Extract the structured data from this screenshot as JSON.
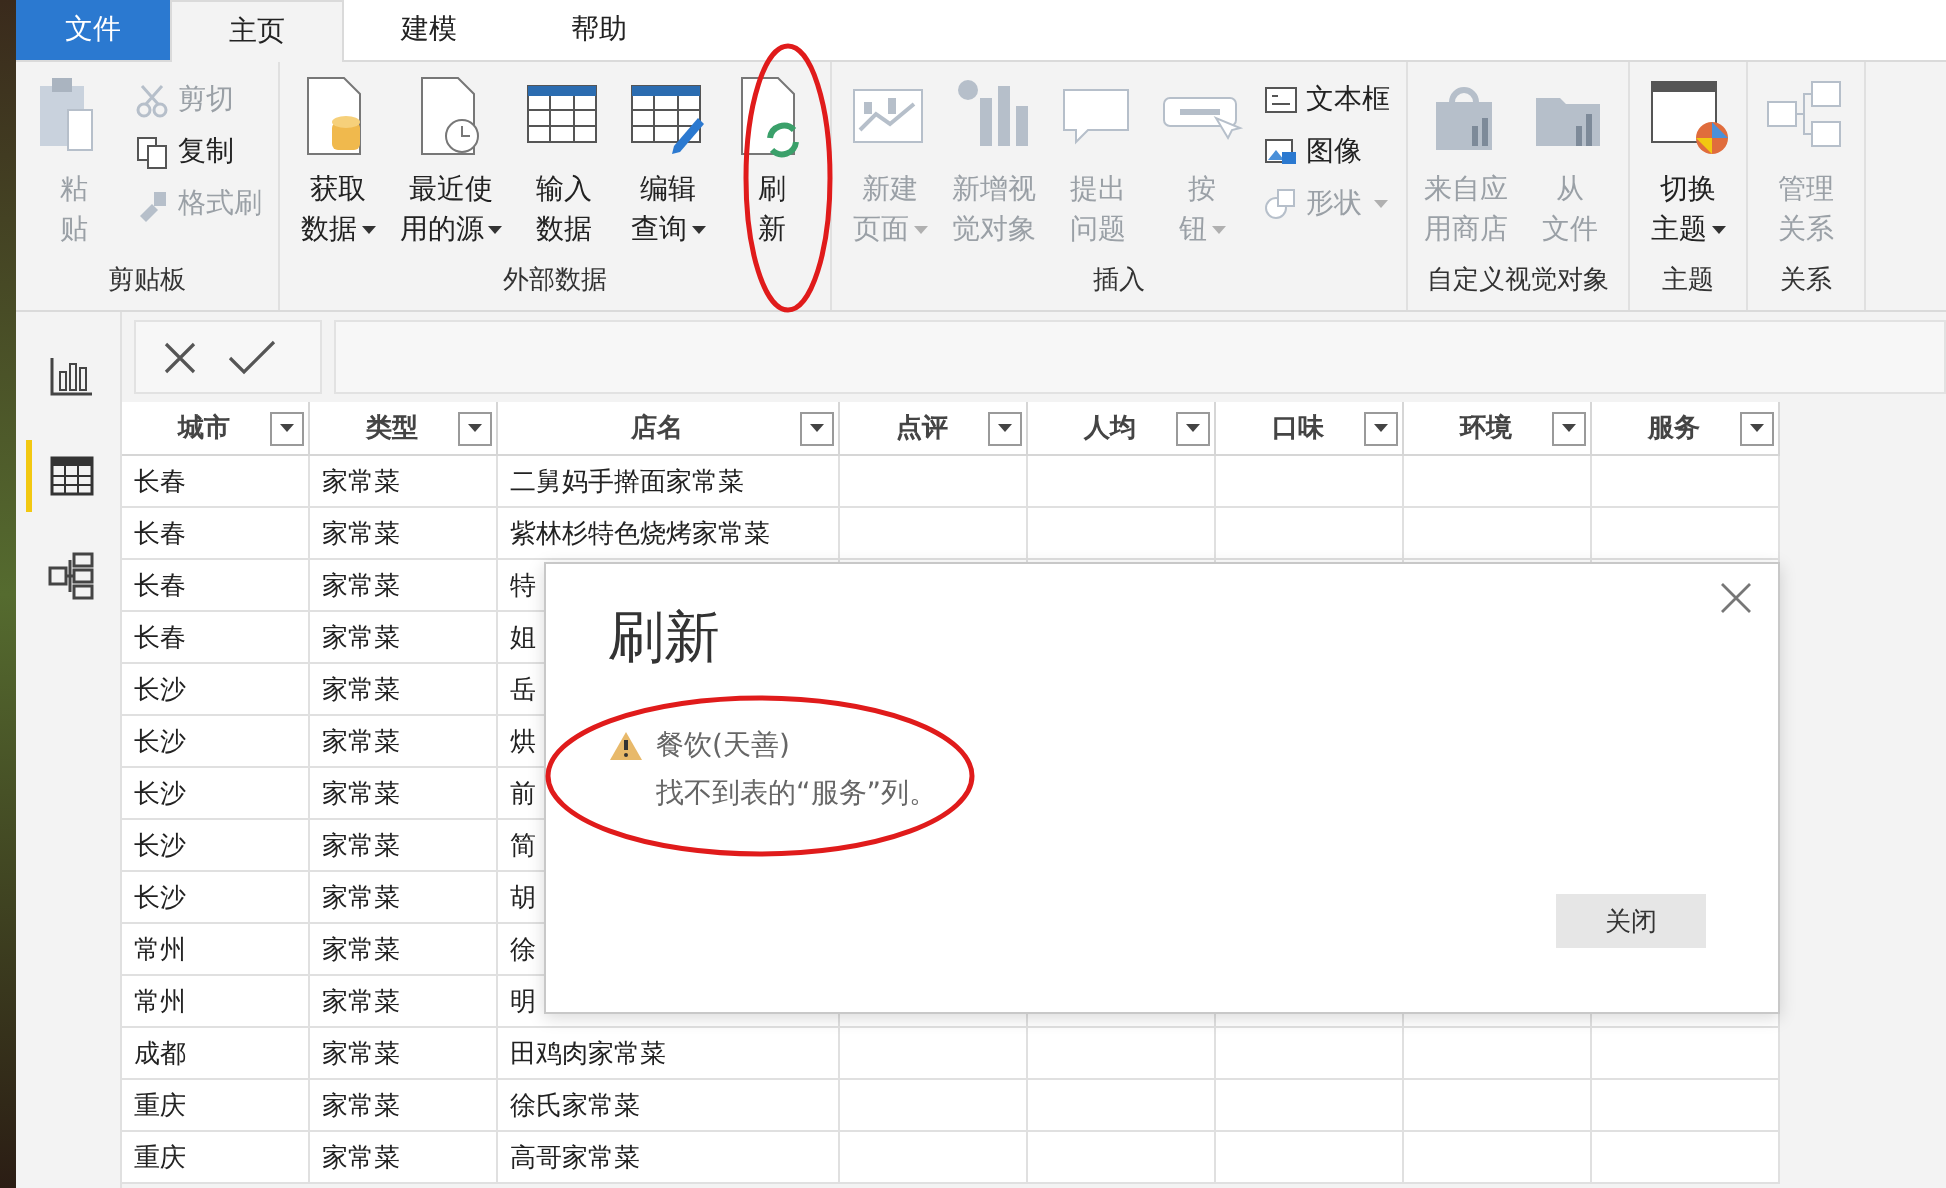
{
  "tabs": [
    {
      "label": "文件",
      "kind": "file",
      "selected": false
    },
    {
      "label": "主页",
      "kind": "tab",
      "selected": true
    },
    {
      "label": "建模",
      "kind": "tab",
      "selected": false
    },
    {
      "label": "帮助",
      "kind": "tab",
      "selected": false
    }
  ],
  "ribbon_groups": [
    {
      "label": "剪贴板",
      "buttons": [
        {
          "kind": "large",
          "lines": [
            "粘",
            "贴"
          ],
          "disabled": true,
          "dropdown": false
        },
        {
          "kind": "small",
          "label": "剪切",
          "disabled": true,
          "dropdown": false
        },
        {
          "kind": "small",
          "label": "复制",
          "disabled": false,
          "dropdown": false
        },
        {
          "kind": "small",
          "label": "格式刷",
          "disabled": true,
          "dropdown": false
        }
      ]
    },
    {
      "label": "外部数据",
      "buttons": [
        {
          "kind": "large",
          "lines": [
            "获取",
            "数据"
          ],
          "disabled": false,
          "dropdown": true
        },
        {
          "kind": "large",
          "lines": [
            "最近使",
            "用的源"
          ],
          "disabled": false,
          "dropdown": true
        },
        {
          "kind": "large",
          "lines": [
            "输入",
            "数据"
          ],
          "disabled": false,
          "dropdown": false
        },
        {
          "kind": "large",
          "lines": [
            "编辑",
            "查询"
          ],
          "disabled": false,
          "dropdown": true
        },
        {
          "kind": "large",
          "lines": [
            "刷",
            "新"
          ],
          "disabled": false,
          "dropdown": false
        }
      ]
    },
    {
      "label": "插入",
      "buttons": [
        {
          "kind": "large",
          "lines": [
            "新建",
            "页面"
          ],
          "disabled": true,
          "dropdown": true
        },
        {
          "kind": "large",
          "lines": [
            "新增视",
            "觉对象"
          ],
          "disabled": true,
          "dropdown": false
        },
        {
          "kind": "large",
          "lines": [
            "提出",
            "问题"
          ],
          "disabled": true,
          "dropdown": false
        },
        {
          "kind": "large",
          "lines": [
            "按",
            "钮"
          ],
          "disabled": true,
          "dropdown": true
        },
        {
          "kind": "small",
          "label": "文本框",
          "disabled": false,
          "dropdown": false
        },
        {
          "kind": "small",
          "label": "图像",
          "disabled": false,
          "dropdown": false
        },
        {
          "kind": "small",
          "label": "形状",
          "disabled": true,
          "dropdown": true
        }
      ]
    },
    {
      "label": "自定义视觉对象",
      "buttons": [
        {
          "kind": "large",
          "lines": [
            "来自应",
            "用商店"
          ],
          "disabled": true,
          "dropdown": false
        },
        {
          "kind": "large",
          "lines": [
            "从",
            "文件"
          ],
          "disabled": true,
          "dropdown": false
        }
      ]
    },
    {
      "label": "主题",
      "buttons": [
        {
          "kind": "large",
          "lines": [
            "切换",
            "主题"
          ],
          "disabled": false,
          "dropdown": true
        }
      ]
    },
    {
      "label": "关系",
      "buttons": [
        {
          "kind": "large",
          "lines": [
            "管理",
            "关系"
          ],
          "disabled": true,
          "dropdown": false
        }
      ]
    }
  ],
  "sidebar": {
    "items": [
      {
        "kind": "report",
        "selected": false
      },
      {
        "kind": "data",
        "selected": true
      },
      {
        "kind": "model",
        "selected": false
      }
    ]
  },
  "table": {
    "columns": [
      "城市",
      "类型",
      "店名",
      "点评",
      "人均",
      "口味",
      "环境",
      "服务"
    ],
    "rows": [
      [
        "长春",
        "家常菜",
        "二舅妈手擀面家常菜",
        "",
        "",
        "",
        "",
        ""
      ],
      [
        "长春",
        "家常菜",
        "紫林杉特色烧烤家常菜",
        "",
        "",
        "",
        "",
        ""
      ],
      [
        "长春",
        "家常菜",
        "特",
        "",
        "",
        "",
        "",
        ""
      ],
      [
        "长春",
        "家常菜",
        "姐",
        "",
        "",
        "",
        "",
        ""
      ],
      [
        "长沙",
        "家常菜",
        "岳",
        "",
        "",
        "",
        "",
        ""
      ],
      [
        "长沙",
        "家常菜",
        "烘",
        "",
        "",
        "",
        "",
        ""
      ],
      [
        "长沙",
        "家常菜",
        "前",
        "",
        "",
        "",
        "",
        ""
      ],
      [
        "长沙",
        "家常菜",
        "简",
        "",
        "",
        "",
        "",
        ""
      ],
      [
        "长沙",
        "家常菜",
        "胡",
        "",
        "",
        "",
        "",
        ""
      ],
      [
        "常州",
        "家常菜",
        "徐",
        "",
        "",
        "",
        "",
        ""
      ],
      [
        "常州",
        "家常菜",
        "明",
        "",
        "",
        "",
        "",
        ""
      ],
      [
        "成都",
        "家常菜",
        "田鸡肉家常菜",
        "",
        "",
        "",
        "",
        ""
      ],
      [
        "重庆",
        "家常菜",
        "徐氏家常菜",
        "",
        "",
        "",
        "",
        ""
      ],
      [
        "重庆",
        "家常菜",
        "高哥家常菜",
        "",
        "",
        "",
        "",
        ""
      ]
    ]
  },
  "dialog": {
    "title": "刷新",
    "source": "餐饮(天善)",
    "message": "找不到表的“服务”列。",
    "button": "关闭"
  }
}
